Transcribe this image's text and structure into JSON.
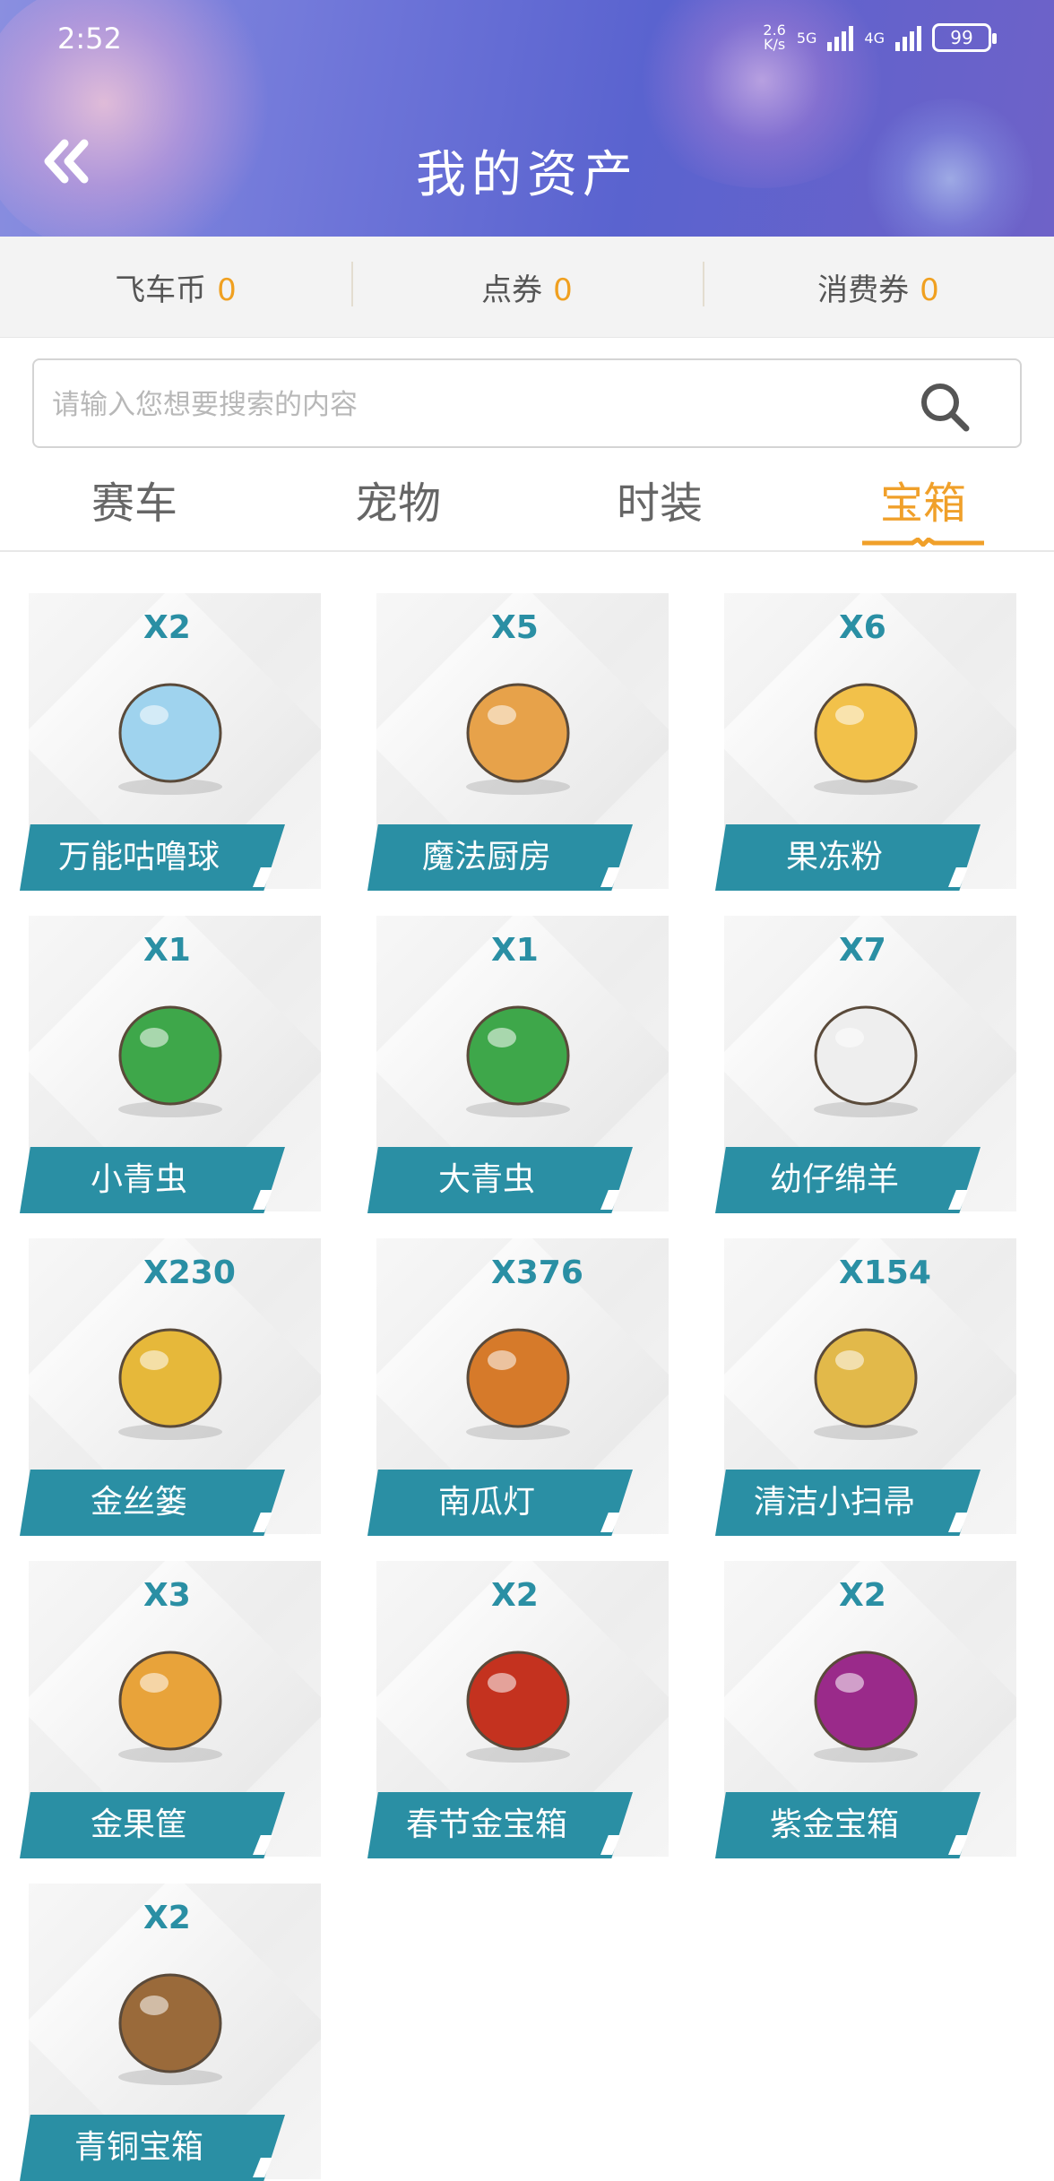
{
  "status_bar": {
    "time": "2:52",
    "net_speed": "2.6\nK/s",
    "net_5g": "5G",
    "net_4g": "4G",
    "battery": "99"
  },
  "header": {
    "title": "我的资产",
    "back_icon": "double-chevron-left-icon"
  },
  "currencies": [
    {
      "label": "飞车币",
      "value": "0"
    },
    {
      "label": "点券",
      "value": "0"
    },
    {
      "label": "消费券",
      "value": "0"
    }
  ],
  "search": {
    "placeholder": "请输入您想要搜索的内容",
    "value": ""
  },
  "tabs": [
    {
      "label": "赛车",
      "active": false
    },
    {
      "label": "宠物",
      "active": false
    },
    {
      "label": "时装",
      "active": false
    },
    {
      "label": "宝箱",
      "active": true
    }
  ],
  "items": [
    {
      "name": "万能咕噜球",
      "count": "X2",
      "icon": "crystal-ball-icon",
      "color": "#9fd3ee"
    },
    {
      "name": "魔法厨房",
      "count": "X5",
      "icon": "kitchen-pot-icon",
      "color": "#e7a24a"
    },
    {
      "name": "果冻粉",
      "count": "X6",
      "icon": "jelly-powder-box-icon",
      "color": "#f2c14a"
    },
    {
      "name": "小青虫",
      "count": "X1",
      "icon": "green-caterpillar-icon",
      "color": "#3ea74a"
    },
    {
      "name": "大青虫",
      "count": "X1",
      "icon": "green-bug-icon",
      "color": "#3ea74a"
    },
    {
      "name": "幼仔绵羊",
      "count": "X7",
      "icon": "sheep-icon",
      "color": "#eeeeee"
    },
    {
      "name": "金丝篓",
      "count": "X230",
      "icon": "golden-basket-icon",
      "color": "#e6b83a"
    },
    {
      "name": "南瓜灯",
      "count": "X376",
      "icon": "pumpkin-lantern-icon",
      "color": "#d67a2a"
    },
    {
      "name": "清洁小扫帚",
      "count": "X154",
      "icon": "broom-icon",
      "color": "#e2b94a"
    },
    {
      "name": "金果筐",
      "count": "X3",
      "icon": "fruit-cornucopia-icon",
      "color": "#e8a33a"
    },
    {
      "name": "春节金宝箱",
      "count": "X2",
      "icon": "red-treasure-chest-icon",
      "color": "#c4321f"
    },
    {
      "name": "紫金宝箱",
      "count": "X2",
      "icon": "purple-treasure-chest-icon",
      "color": "#9a2a8a"
    },
    {
      "name": "青铜宝箱",
      "count": "X2",
      "icon": "bronze-treasure-chest-icon",
      "color": "#9a6a3a"
    }
  ],
  "colors": {
    "accent": "#f0a02a",
    "teal": "#2a8fa4"
  }
}
